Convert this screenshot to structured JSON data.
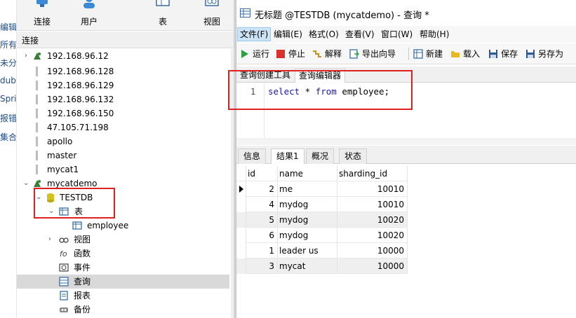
{
  "left_strip": {
    "items": [
      "编辑",
      "所有",
      "未分",
      "dubl",
      "Spri",
      "报错",
      "集合"
    ]
  },
  "main_toolbar": {
    "buttons": [
      {
        "label": "连接",
        "icon": "connection-icon"
      },
      {
        "label": "用户",
        "icon": "user-icon"
      },
      {
        "label": "表",
        "icon": "table-icon"
      },
      {
        "label": "视图",
        "icon": "view-icon"
      }
    ]
  },
  "connections_panel": {
    "header": "连接",
    "tree": [
      {
        "label": "192.168.96.12",
        "icon": "mysql-connection-icon"
      },
      {
        "label": "192.168.96.128",
        "icon": "connection-closed-icon"
      },
      {
        "label": "192.168.96.129",
        "icon": "connection-closed-icon"
      },
      {
        "label": "192.168.96.132",
        "icon": "connection-closed-icon"
      },
      {
        "label": "192.168.96.150",
        "icon": "connection-closed-icon"
      },
      {
        "label": "47.105.71.198",
        "icon": "connection-closed-icon"
      },
      {
        "label": "apollo",
        "icon": "connection-closed-icon"
      },
      {
        "label": "master",
        "icon": "connection-closed-icon"
      },
      {
        "label": "mycat1",
        "icon": "connection-closed-icon"
      },
      {
        "label": "mycatdemo",
        "icon": "mysql-connection-icon"
      },
      {
        "label": "TESTDB",
        "icon": "database-icon"
      },
      {
        "label": "表",
        "icon": "tables-folder-icon"
      },
      {
        "label": "employee",
        "icon": "table-icon"
      },
      {
        "label": "视图",
        "icon": "views-icon"
      },
      {
        "label": "函数",
        "icon": "function-icon"
      },
      {
        "label": "事件",
        "icon": "event-icon"
      },
      {
        "label": "查询",
        "icon": "query-icon"
      },
      {
        "label": "报表",
        "icon": "report-icon"
      },
      {
        "label": "备份",
        "icon": "backup-icon"
      }
    ]
  },
  "query_window": {
    "title": "无标题 @TESTDB (mycatdemo) - 查询 *",
    "menu": [
      {
        "label": "文件(F)",
        "active": true
      },
      {
        "label": "编辑(E)"
      },
      {
        "label": "格式(O)"
      },
      {
        "label": "查看(V)"
      },
      {
        "label": "窗口(W)"
      },
      {
        "label": "帮助(H)"
      }
    ],
    "toolbar": {
      "run": "运行",
      "stop": "停止",
      "explain": "解释",
      "export_wizard": "导出向导",
      "new": "新建",
      "load": "载入",
      "save": "保存",
      "save_as": "另存为"
    },
    "subtabs": [
      "查询创建工具",
      "查询编辑器"
    ],
    "editor": {
      "line_number": "1",
      "kw_select": "select",
      "star": " * ",
      "kw_from": "from",
      "rest": " employee;"
    },
    "result_tabs": [
      "信息",
      "结果1",
      "概况",
      "状态"
    ],
    "grid": {
      "columns": [
        "id",
        "name",
        "sharding_id"
      ],
      "rows": [
        {
          "id": "2",
          "name": "me",
          "sharding_id": "10010"
        },
        {
          "id": "4",
          "name": "mydog",
          "sharding_id": "10010"
        },
        {
          "id": "5",
          "name": "mydog",
          "sharding_id": "10020"
        },
        {
          "id": "6",
          "name": "mydog",
          "sharding_id": "10020"
        },
        {
          "id": "1",
          "name": "leader us",
          "sharding_id": "10000"
        },
        {
          "id": "3",
          "name": "mycat",
          "sharding_id": "10000"
        }
      ]
    }
  },
  "colors": {
    "highlight_box": "#e02020",
    "keyword": "#1a1aa6",
    "selected_row": "#d9d9d9"
  }
}
